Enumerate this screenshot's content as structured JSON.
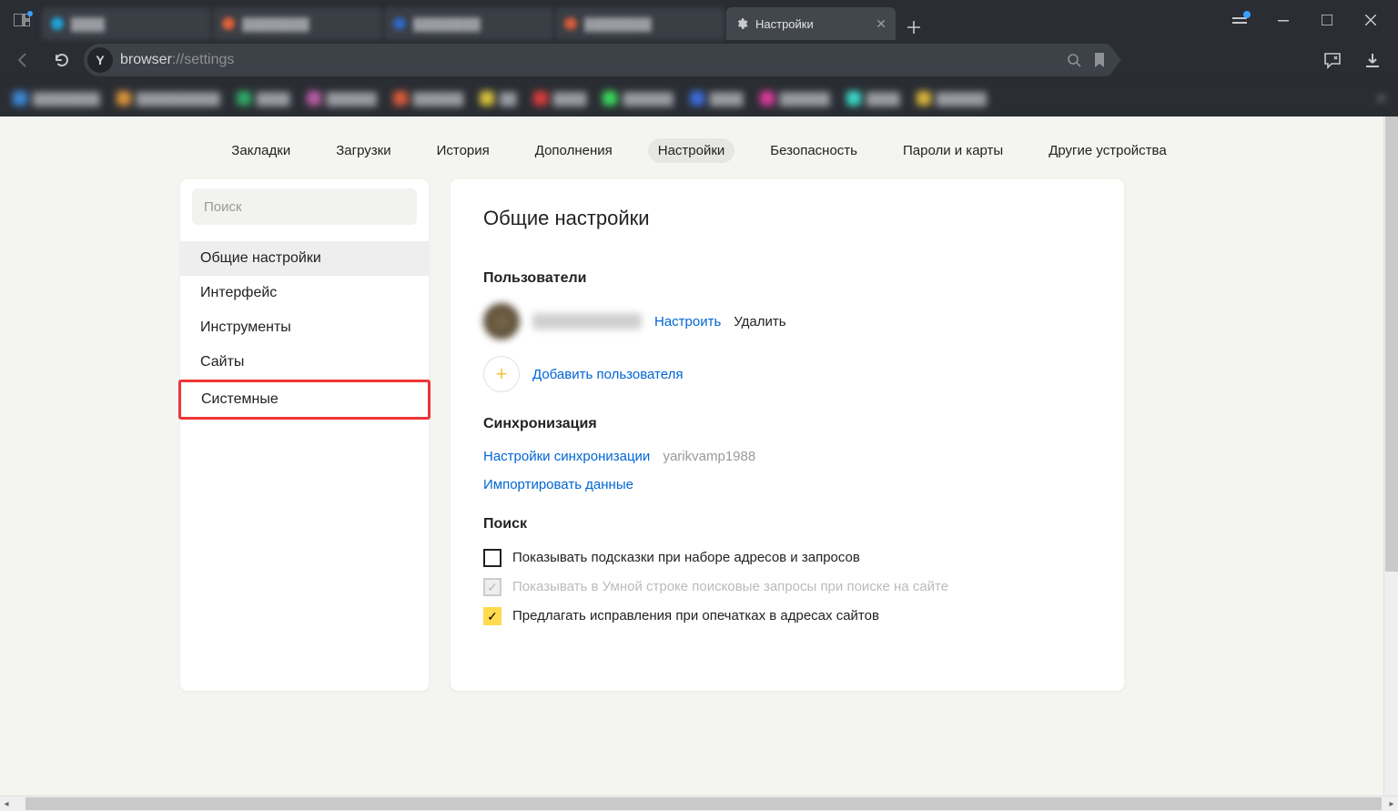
{
  "tab": {
    "title": "Настройки"
  },
  "url": {
    "prefix": "browser",
    "rest": "://settings"
  },
  "nav": {
    "bookmarks": "Закладки",
    "downloads": "Загрузки",
    "history": "История",
    "addons": "Дополнения",
    "settings": "Настройки",
    "security": "Безопасность",
    "passwords": "Пароли и карты",
    "devices": "Другие устройства"
  },
  "sidebar": {
    "search_ph": "Поиск",
    "general": "Общие настройки",
    "interface": "Интерфейс",
    "tools": "Инструменты",
    "sites": "Сайты",
    "system": "Системные"
  },
  "main": {
    "h1": "Общие настройки",
    "users_h": "Пользователи",
    "user_configure": "Настроить",
    "user_delete": "Удалить",
    "add_user": "Добавить пользователя",
    "sync_h": "Синхронизация",
    "sync_settings": "Настройки синхронизации",
    "sync_user": "yarikvamp1988",
    "sync_import": "Импортировать данные",
    "search_h": "Поиск",
    "search_opt1": "Показывать подсказки при наборе адресов и запросов",
    "search_opt2": "Показывать в Умной строке поисковые запросы при поиске на сайте",
    "search_opt3": "Предлагать исправления при опечатках в адресах сайтов"
  }
}
